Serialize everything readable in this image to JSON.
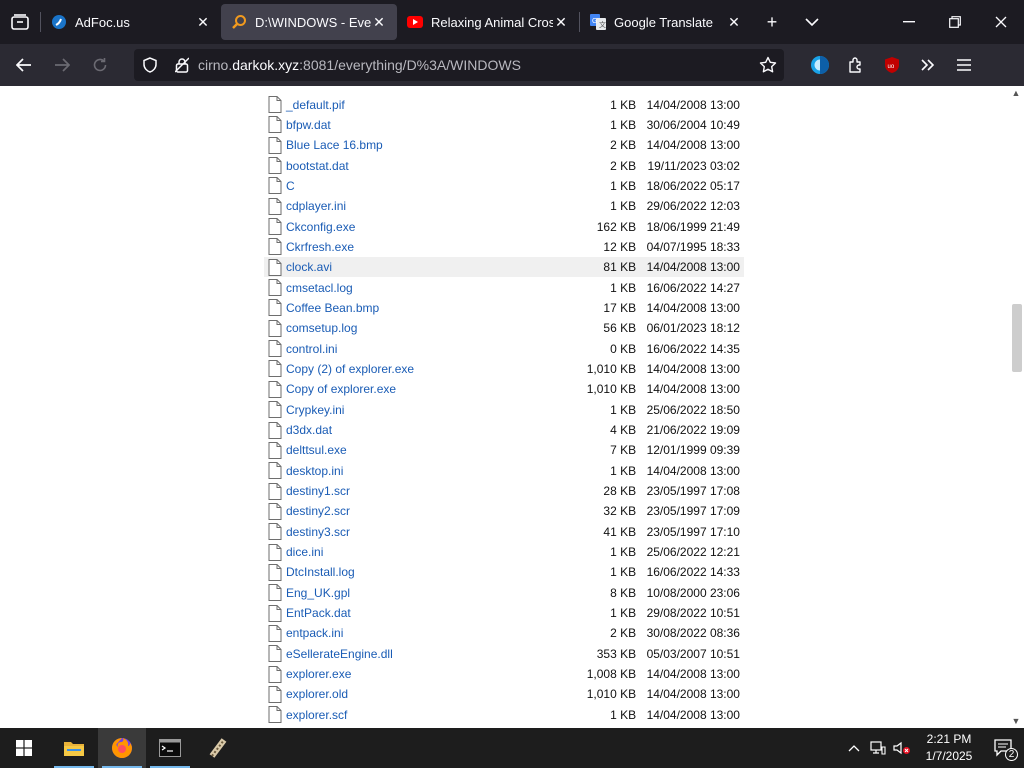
{
  "browser": {
    "tabs": [
      {
        "title": "AdFoc.us",
        "icon": "adfocus-icon",
        "active": false
      },
      {
        "title": "D:\\WINDOWS - Everyth",
        "icon": "everything-search-icon",
        "active": true
      },
      {
        "title": "Relaxing Animal Crossi",
        "icon": "youtube-icon",
        "active": false
      },
      {
        "title": "Google Translate",
        "icon": "google-translate-icon",
        "active": false
      }
    ],
    "url": {
      "prefix": "cirno.",
      "host": "darkok.xyz",
      "suffix": ":8081/everything/D%3A/WINDOWS"
    }
  },
  "files": [
    {
      "name": "_default.pif",
      "size": "1 KB",
      "date": "14/04/2008 13:00"
    },
    {
      "name": "bfpw.dat",
      "size": "1 KB",
      "date": "30/06/2004 10:49"
    },
    {
      "name": "Blue Lace 16.bmp",
      "size": "2 KB",
      "date": "14/04/2008 13:00"
    },
    {
      "name": "bootstat.dat",
      "size": "2 KB",
      "date": "19/11/2023 03:02"
    },
    {
      "name": "C",
      "size": "1 KB",
      "date": "18/06/2022 05:17"
    },
    {
      "name": "cdplayer.ini",
      "size": "1 KB",
      "date": "29/06/2022 12:03"
    },
    {
      "name": "Ckconfig.exe",
      "size": "162 KB",
      "date": "18/06/1999 21:49"
    },
    {
      "name": "Ckrfresh.exe",
      "size": "12 KB",
      "date": "04/07/1995 18:33"
    },
    {
      "name": "clock.avi",
      "size": "81 KB",
      "date": "14/04/2008 13:00"
    },
    {
      "name": "cmsetacl.log",
      "size": "1 KB",
      "date": "16/06/2022 14:27"
    },
    {
      "name": "Coffee Bean.bmp",
      "size": "17 KB",
      "date": "14/04/2008 13:00"
    },
    {
      "name": "comsetup.log",
      "size": "56 KB",
      "date": "06/01/2023 18:12"
    },
    {
      "name": "control.ini",
      "size": "0 KB",
      "date": "16/06/2022 14:35"
    },
    {
      "name": "Copy (2) of explorer.exe",
      "size": "1,010 KB",
      "date": "14/04/2008 13:00"
    },
    {
      "name": "Copy of explorer.exe",
      "size": "1,010 KB",
      "date": "14/04/2008 13:00"
    },
    {
      "name": "Crypkey.ini",
      "size": "1 KB",
      "date": "25/06/2022 18:50"
    },
    {
      "name": "d3dx.dat",
      "size": "4 KB",
      "date": "21/06/2022 19:09"
    },
    {
      "name": "delttsul.exe",
      "size": "7 KB",
      "date": "12/01/1999 09:39"
    },
    {
      "name": "desktop.ini",
      "size": "1 KB",
      "date": "14/04/2008 13:00"
    },
    {
      "name": "destiny1.scr",
      "size": "28 KB",
      "date": "23/05/1997 17:08"
    },
    {
      "name": "destiny2.scr",
      "size": "32 KB",
      "date": "23/05/1997 17:09"
    },
    {
      "name": "destiny3.scr",
      "size": "41 KB",
      "date": "23/05/1997 17:10"
    },
    {
      "name": "dice.ini",
      "size": "1 KB",
      "date": "25/06/2022 12:21"
    },
    {
      "name": "DtcInstall.log",
      "size": "1 KB",
      "date": "16/06/2022 14:33"
    },
    {
      "name": "Eng_UK.gpl",
      "size": "8 KB",
      "date": "10/08/2000 23:06"
    },
    {
      "name": "EntPack.dat",
      "size": "1 KB",
      "date": "29/08/2022 10:51"
    },
    {
      "name": "entpack.ini",
      "size": "2 KB",
      "date": "30/08/2022 08:36"
    },
    {
      "name": "eSellerateEngine.dll",
      "size": "353 KB",
      "date": "05/03/2007 10:51"
    },
    {
      "name": "explorer.exe",
      "size": "1,008 KB",
      "date": "14/04/2008 13:00"
    },
    {
      "name": "explorer.old",
      "size": "1,010 KB",
      "date": "14/04/2008 13:00"
    },
    {
      "name": "explorer.scf",
      "size": "1 KB",
      "date": "14/04/2008 13:00"
    }
  ],
  "hovered_row": "clock.avi",
  "taskbar": {
    "apps": [
      "file-explorer-icon",
      "firefox-icon",
      "terminal-icon",
      "film-app-icon"
    ],
    "clock": {
      "time": "2:21 PM",
      "date": "1/7/2025"
    },
    "notification_count": "2"
  },
  "colors": {
    "link": "#1a5cb5",
    "tab_bg": "#1c1b22",
    "nav_bg": "#2b2a33",
    "taskbar": "#1d1d1d"
  }
}
